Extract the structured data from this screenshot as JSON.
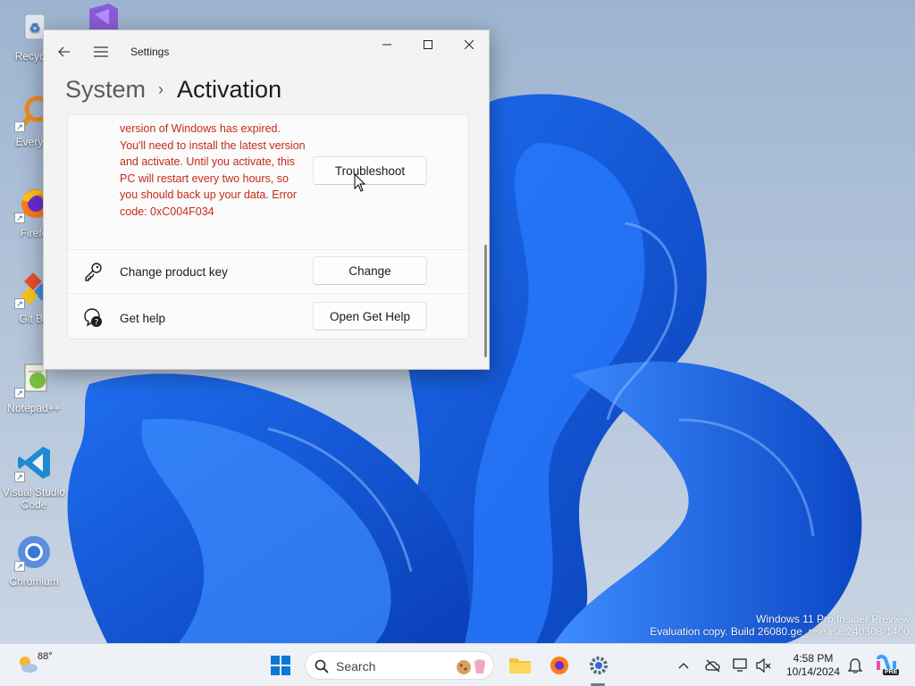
{
  "desktop": {
    "icons": [
      {
        "label": "Recycle"
      },
      {
        "label": "Everyth"
      },
      {
        "label": "Firefo"
      },
      {
        "label": "Git Ba"
      },
      {
        "label": "Notepad++"
      },
      {
        "label": "Visual Studio Code"
      },
      {
        "label": "Chromium"
      }
    ],
    "watermark": {
      "line1": "Windows 11 Pro Insider Preview",
      "line2": "Evaluation copy. Build 26080.ge_release.240308-1400"
    }
  },
  "window": {
    "app_title": "Settings",
    "breadcrumb": {
      "parent": "System",
      "separator": "›",
      "current": "Activation"
    },
    "error_message": "version of Windows has expired. You'll need to install the latest version and activate. Until you activate, this PC will restart every two hours, so you should back up your data. Error code: 0xC004F034",
    "troubleshoot_label": "Troubleshoot",
    "rows": [
      {
        "label": "Change product key",
        "button": "Change",
        "icon": "key-icon"
      },
      {
        "label": "Get help",
        "button": "Open Get Help",
        "icon": "help-icon"
      }
    ]
  },
  "taskbar": {
    "weather_temp": "88°",
    "search_label": "Search",
    "clock_time": "4:58 PM",
    "clock_date": "10/14/2024",
    "copilot_badge": "PRE"
  },
  "colors": {
    "error_text": "#c42b1c",
    "accent": "#0067c0"
  }
}
